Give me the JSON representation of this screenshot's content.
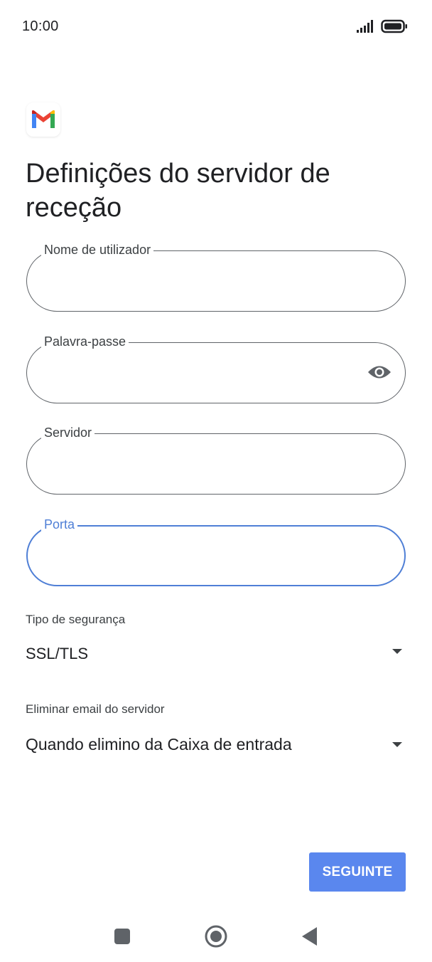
{
  "status_bar": {
    "time": "10:00",
    "icons": [
      "signal-icon",
      "battery-icon"
    ]
  },
  "app": {
    "logo_icon": "gmail-logo-icon",
    "title": "Definições do servidor de receção"
  },
  "form": {
    "username": {
      "label": "Nome de utilizador",
      "value": ""
    },
    "password": {
      "label": "Palavra-passe",
      "value": "",
      "toggle_icon": "eye-icon"
    },
    "server": {
      "label": "Servidor",
      "value": ""
    },
    "port": {
      "label": "Porta",
      "value": "",
      "focused": true
    }
  },
  "security": {
    "label": "Tipo de segurança",
    "selected": "SSL/TLS"
  },
  "delete_email": {
    "label": "Eliminar email do servidor",
    "selected": "Quando elimino da Caixa de entrada"
  },
  "actions": {
    "next_label": "SEGUINTE"
  },
  "nav_bar": {
    "icons": [
      "recents-square-icon",
      "home-circle-icon",
      "back-triangle-icon"
    ]
  },
  "colors": {
    "accent": "#4f7fd6",
    "button": "#5a87ee",
    "text": "#202124",
    "outline": "#5f6368"
  }
}
